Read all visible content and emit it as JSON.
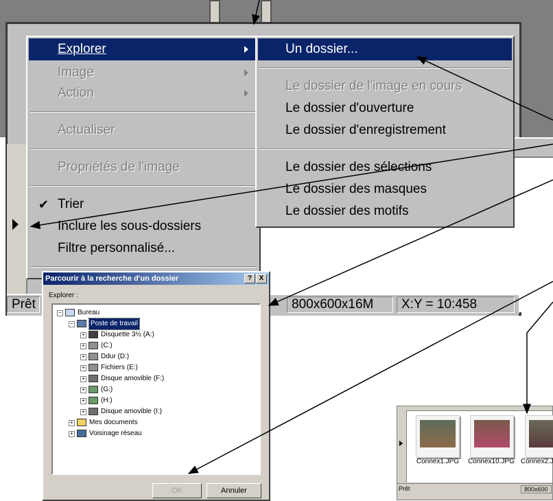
{
  "main_menu": {
    "items": [
      {
        "label": "Explorer",
        "accel": "E",
        "state": "selected",
        "submenu": true
      },
      {
        "label": "Image",
        "accel": "I",
        "state": "disabled",
        "submenu": true
      },
      {
        "label": "Action",
        "accel": "A",
        "state": "disabled",
        "submenu": true
      },
      {
        "label": "Actualiser",
        "accel": "c",
        "state": "disabled"
      },
      {
        "label": "Propriétés de l'image",
        "accel": "P",
        "state": "disabled"
      },
      {
        "label": "Trier",
        "accel": "T",
        "state": "checked"
      },
      {
        "label": "Inclure les sous-dossiers",
        "accel": "I",
        "state": "normal"
      },
      {
        "label": "Filtre personnalisé...",
        "accel": "F",
        "state": "normal"
      }
    ],
    "check_glyph": "✔"
  },
  "sub_menu": {
    "items": [
      {
        "label": "Un dossier...",
        "state": "selected"
      },
      {
        "label": "Le dossier de l'image en cours",
        "state": "disabled"
      },
      {
        "label": "Le dossier d'ouverture",
        "state": "normal"
      },
      {
        "label": "Le dossier d'enregistrement",
        "state": "normal"
      },
      {
        "label": "Le dossier des sélections",
        "state": "normal"
      },
      {
        "label": "Le dossier des masques",
        "state": "normal"
      },
      {
        "label": "Le dossier des motifs",
        "state": "normal"
      }
    ]
  },
  "status_bar": {
    "ready": "Prêt",
    "resolution": "800x600x16M",
    "coords": "X:Y = 10:458"
  },
  "dialog": {
    "title": "Parcourir à la recherche d'un dossier",
    "help_btn": "?",
    "close_btn": "X",
    "prompt": "Explorer :",
    "tree": [
      {
        "label": "Bureau",
        "icon": "desktop-icon",
        "level": 0,
        "toggle": "−"
      },
      {
        "label": "Poste de travail",
        "icon": "computer-icon",
        "level": 1,
        "toggle": "−",
        "selected": true
      },
      {
        "label": "Disquette 3½ (A:)",
        "icon": "floppy-icon",
        "level": 2,
        "toggle": "+"
      },
      {
        "label": "(C:)",
        "icon": "drive-icon",
        "level": 2,
        "toggle": "+"
      },
      {
        "label": "Ddur (D:)",
        "icon": "drive-icon",
        "level": 2,
        "toggle": "+"
      },
      {
        "label": "Fichiers (E:)",
        "icon": "drive-icon",
        "level": 2,
        "toggle": "+"
      },
      {
        "label": "Disque amovible (F:)",
        "icon": "removable-drive-icon",
        "level": 2,
        "toggle": "+"
      },
      {
        "label": "(G:)",
        "icon": "cd-drive-icon",
        "level": 2,
        "toggle": "+"
      },
      {
        "label": "(H:)",
        "icon": "cd-drive-icon",
        "level": 2,
        "toggle": "+"
      },
      {
        "label": "Disque amovible (I:)",
        "icon": "removable-drive-icon",
        "level": 2,
        "toggle": "+"
      },
      {
        "label": "Mes documents",
        "icon": "folder-icon",
        "level": 1,
        "toggle": "+"
      },
      {
        "label": "Voisinage réseau",
        "icon": "network-icon",
        "level": 1,
        "toggle": "+"
      }
    ],
    "ok": "OK",
    "cancel": "Annuler"
  },
  "thumbnails": {
    "items": [
      {
        "caption": "Connex1.JPG"
      },
      {
        "caption": "Connex10.JPG"
      },
      {
        "caption": "Connex2.J"
      }
    ],
    "status_ready": "Prêt",
    "status_res": "800x600"
  },
  "colors": {
    "highlight": "#0a246a",
    "menu_bg": "#c0c0c0",
    "dialog_bg": "#d4d0c8"
  }
}
